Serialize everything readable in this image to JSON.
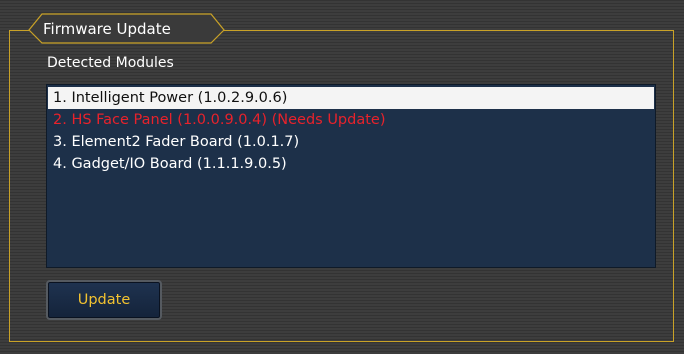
{
  "panel": {
    "title": "Firmware Update",
    "section_label": "Detected Modules"
  },
  "modules": [
    {
      "label": "1. Intelligent Power (1.0.2.9.0.6)",
      "state": "selected"
    },
    {
      "label": "2. HS Face Panel (1.0.0.9.0.4) (Needs Update)",
      "state": "needs-update"
    },
    {
      "label": "3. Element2 Fader Board (1.0.1.7)",
      "state": "normal"
    },
    {
      "label": "4. Gadget/IO Board (1.1.1.9.0.5)",
      "state": "normal"
    }
  ],
  "actions": {
    "update_label": "Update"
  },
  "colors": {
    "panel_border": "#c9a227",
    "list_background": "#1d3049",
    "selected_row": "#f4f4f4",
    "warning_text": "#e8222b",
    "button_text": "#f2c230"
  }
}
